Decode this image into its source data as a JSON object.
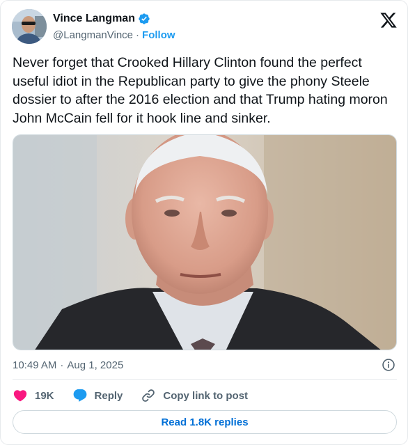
{
  "author": {
    "name": "Vince Langman",
    "handle": "@LangmanVince",
    "separator": "·",
    "follow_label": "Follow",
    "verified": true
  },
  "brand": {
    "logo_icon": "x-logo-icon"
  },
  "tweet": {
    "text": "Never forget that Crooked Hillary Clinton found the perfect useful idiot in the Republican party to give the phony Steele dossier to after the 2016 election and that Trump hating moron John McCain fell for it hook line and sinker."
  },
  "meta": {
    "time": "10:49 AM",
    "separator": "·",
    "date": "Aug 1, 2025"
  },
  "actions": {
    "likes": "19K",
    "reply_label": "Reply",
    "copy_label": "Copy link to post"
  },
  "footer": {
    "read_replies_label": "Read 1.8K replies"
  },
  "colors": {
    "accent": "#1d9bf0",
    "like": "#f91880",
    "text": "#0f1419",
    "muted": "#536471"
  }
}
